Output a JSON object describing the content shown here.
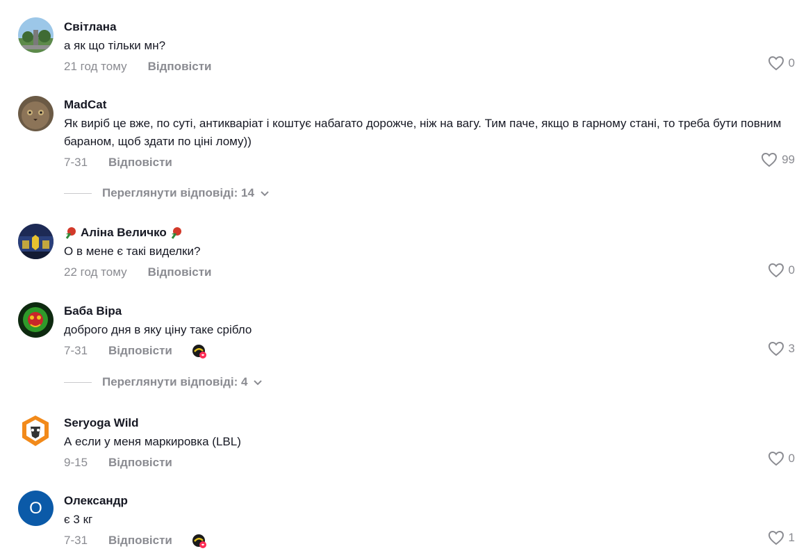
{
  "comments": [
    {
      "username": "Світлана",
      "text": "а як що тільки мн?",
      "date": "21 год тому",
      "reply": "Відповісти",
      "likes": "0"
    },
    {
      "username": "MadCat",
      "text": "Як виріб це вже, по суті, антикваріат і коштує набагато дорожче, ніж на вагу. Тим паче, якщо в гарному стані, то треба бути повним бараном, щоб здати по ціні лому))",
      "date": "7-31",
      "reply": "Відповісти",
      "likes": "99",
      "view_replies": "Переглянути відповіді: 14"
    },
    {
      "username": "Аліна Величко",
      "text": "О в мене є такі виделки?",
      "date": "22 год тому",
      "reply": "Відповісти",
      "likes": "0"
    },
    {
      "username": "Баба Віра",
      "text": "доброго дня в яку ціну таке срібло",
      "date": "7-31",
      "reply": "Відповісти",
      "likes": "3",
      "view_replies": "Переглянути відповіді: 4"
    },
    {
      "username": "Seryoga Wild",
      "text": "А если у меня маркировка (LBL)",
      "date": "9-15",
      "reply": "Відповісти",
      "likes": "0"
    },
    {
      "username": "Олександр",
      "avatar_letter": "О",
      "text": "є 3 кг",
      "date": "7-31",
      "reply": "Відповісти",
      "likes": "1"
    }
  ],
  "colors": {
    "muted": "#8a8b91",
    "text": "#161823",
    "avatar_blue": "#0b5aa8"
  }
}
